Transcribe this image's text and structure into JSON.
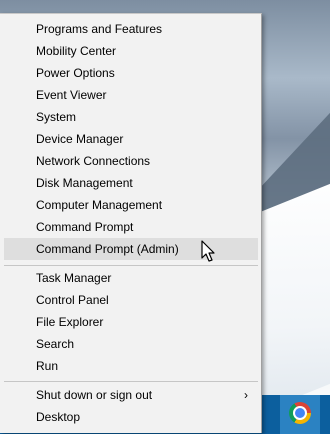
{
  "menu": {
    "groups": [
      [
        {
          "label": "Programs and Features"
        },
        {
          "label": "Mobility Center"
        },
        {
          "label": "Power Options"
        },
        {
          "label": "Event Viewer"
        },
        {
          "label": "System"
        },
        {
          "label": "Device Manager"
        },
        {
          "label": "Network Connections"
        },
        {
          "label": "Disk Management"
        },
        {
          "label": "Computer Management"
        },
        {
          "label": "Command Prompt"
        },
        {
          "label": "Command Prompt (Admin)",
          "hovered": true
        }
      ],
      [
        {
          "label": "Task Manager"
        },
        {
          "label": "Control Panel"
        },
        {
          "label": "File Explorer"
        },
        {
          "label": "Search"
        },
        {
          "label": "Run"
        }
      ],
      [
        {
          "label": "Shut down or sign out",
          "submenu_arrow": "›"
        },
        {
          "label": "Desktop"
        }
      ]
    ]
  },
  "taskbar": {
    "pinned_app_icon": "chrome-icon"
  },
  "colors": {
    "menu_background": "#f2f2f2",
    "hover_highlight": "#dedede",
    "taskbar": "#0c5f9e",
    "taskbar_active_button": "#2b82c2"
  }
}
